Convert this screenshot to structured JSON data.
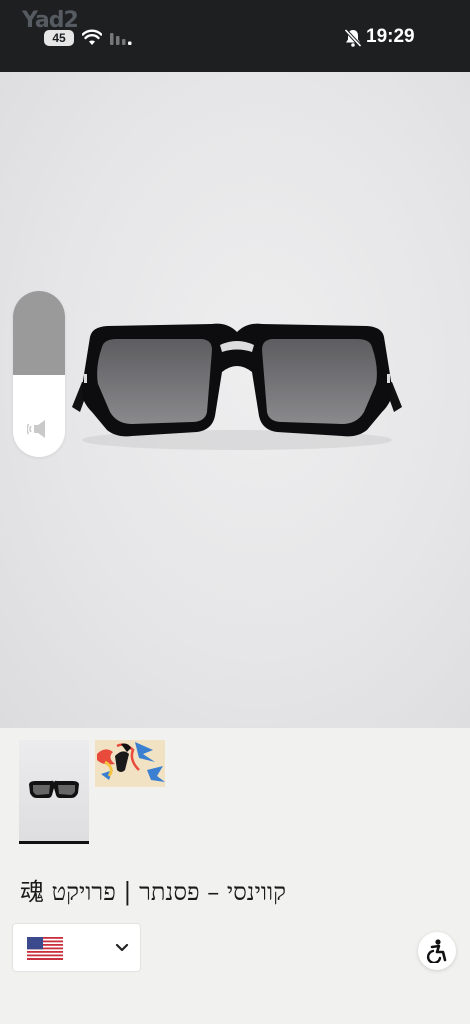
{
  "status_bar": {
    "watermark": "Yad2",
    "battery": "45",
    "time": "19:29"
  },
  "product": {
    "title": "קווינסי – פסנתר | פרויקט 魂"
  },
  "currency": {
    "flag": "us-flag-icon"
  },
  "icons": {
    "wifi": "wifi-icon",
    "signal": "signal-icon",
    "mute": "bell-slash-icon",
    "speaker": "speaker-icon",
    "chevron": "chevron-down-icon",
    "accessibility": "accessibility-icon"
  },
  "colors": {
    "status_bar_bg": "#1d1f21",
    "page_bg": "#f1f2ef"
  }
}
